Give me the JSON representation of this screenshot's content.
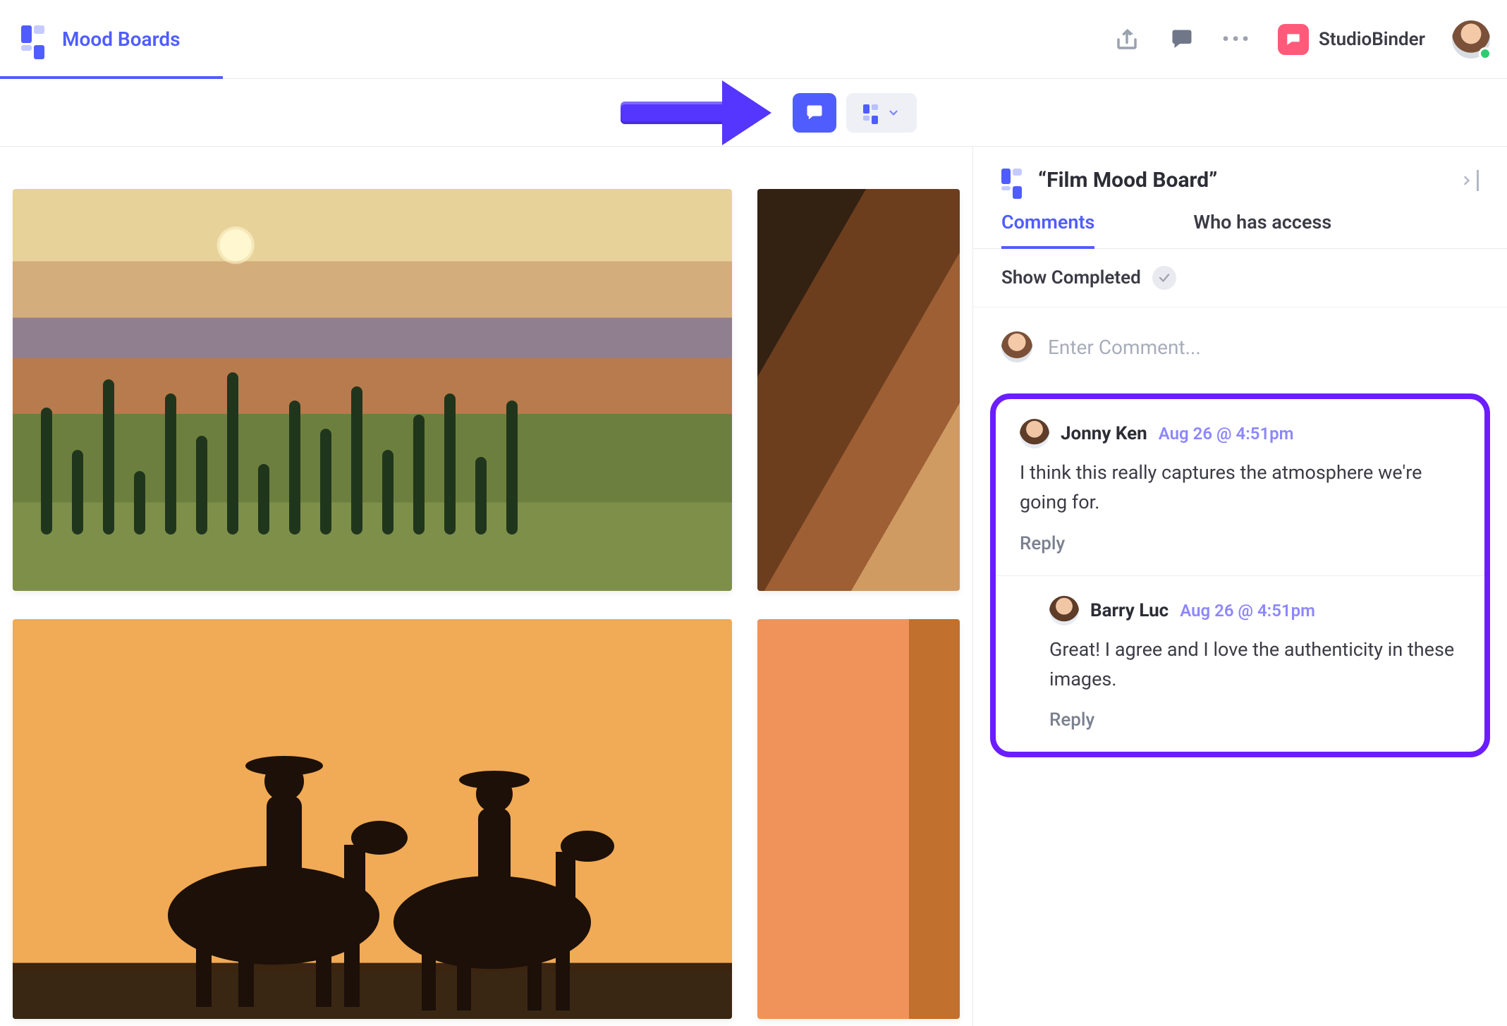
{
  "topbar": {
    "page_title": "Mood Boards",
    "brand_label": "StudioBinder"
  },
  "sidepanel": {
    "title": "“Film Mood Board”",
    "tabs": {
      "comments": "Comments",
      "access": "Who has access"
    },
    "filter_label": "Show Completed",
    "input_placeholder": "Enter Comment...",
    "reply_label": "Reply",
    "comments": [
      {
        "author": "Jonny Ken",
        "time": "Aug 26 @ 4:51pm",
        "body": "I think this really captures the atmosphere we're going for."
      },
      {
        "author": "Barry Luc",
        "time": "Aug 26 @ 4:51pm",
        "body": "Great! I agree and I love the authenticity in these images."
      }
    ]
  }
}
